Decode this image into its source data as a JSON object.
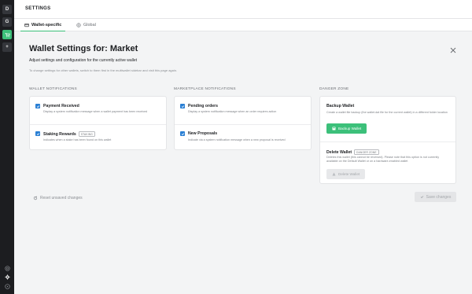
{
  "rail": {
    "items": [
      {
        "label": "D",
        "active": false
      },
      {
        "label": "G",
        "active": false
      },
      {
        "label": "",
        "icon": "cart-icon",
        "active": true
      },
      {
        "label": "+",
        "active": false
      }
    ],
    "bottom_icons": [
      "help-icon",
      "gear-icon",
      "info-icon"
    ]
  },
  "header": {
    "title": "SETTINGS"
  },
  "tabs": [
    {
      "label": "Wallet-specific",
      "icon": "wallet-icon",
      "active": true
    },
    {
      "label": "Global",
      "icon": "globe-icon",
      "active": false
    }
  ],
  "page": {
    "title": "Wallet Settings for: Market",
    "subtitle": "Adjust settings and configuration for the currently active wallet",
    "hint": "To change settings for other wallets, switch to them first in the multiwallet sidebar and visit this page again."
  },
  "wallet_notifications": {
    "heading": "WALLET NOTIFICATIONS",
    "items": [
      {
        "title": "Payment Received",
        "badge": "",
        "desc": "Display a system notification message when a wallet payment has been received",
        "checked": true
      },
      {
        "title": "Staking Rewards",
        "badge": "STAKING",
        "desc": "Indicates when a stake has been found on this wallet",
        "checked": true
      }
    ]
  },
  "marketplace_notifications": {
    "heading": "MARKETPLACE NOTIFICATIONS",
    "items": [
      {
        "title": "Pending orders",
        "desc": "Display a system notification message when an order requires action",
        "checked": true
      },
      {
        "title": "New Proposals",
        "desc": "Indicate via a system notification message when a new proposal is received",
        "checked": true
      }
    ]
  },
  "danger_zone": {
    "heading": "DANGER ZONE",
    "backup": {
      "title": "Backup Wallet",
      "desc": "Create a wallet file backup (the wallet.dat file for the current wallet) in a different folder location",
      "button": "Backup Wallet"
    },
    "delete": {
      "title": "Delete Wallet",
      "badge": "DANGER ZONE",
      "desc": "Deletes this wallet (this cannot be reversed). Please note that this option is not currently available on the Default Wallet or on a hardware-enabled wallet",
      "button": "Delete Wallet"
    }
  },
  "footer": {
    "reset_label": "Reset unsaved changes",
    "save_label": "Save changes"
  },
  "colors": {
    "accent": "#3cc07a",
    "checkbox": "#2a7fd4",
    "rail": "#1c1d20"
  }
}
